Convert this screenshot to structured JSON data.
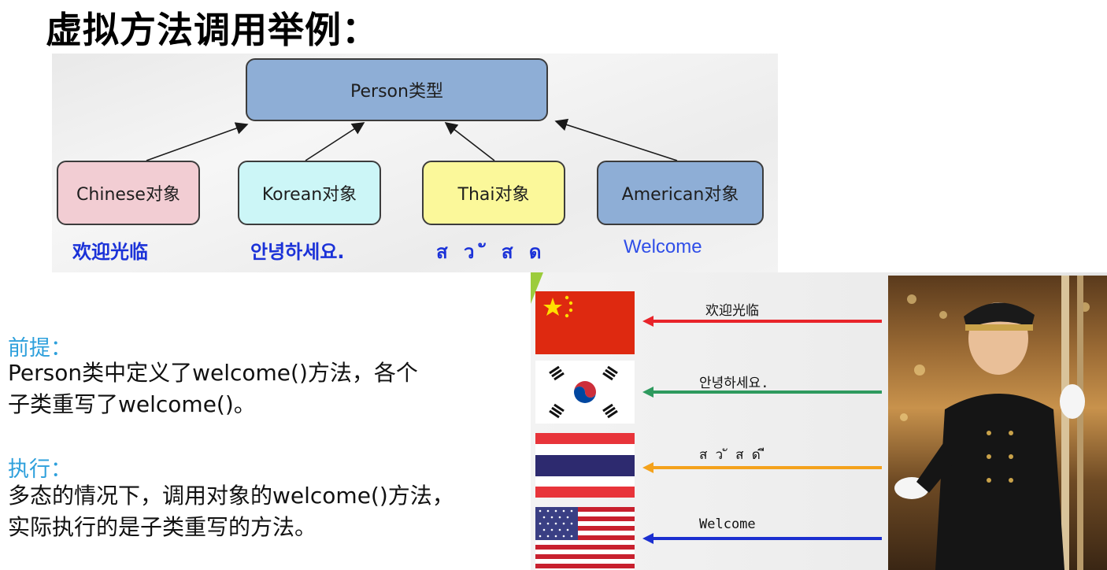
{
  "title": "虚拟方法调用举例：",
  "diagram": {
    "parent": "Person类型",
    "children": [
      {
        "label": "Chinese对象",
        "greeting": "欢迎光临"
      },
      {
        "label": "Korean对象",
        "greeting": "안녕하세요."
      },
      {
        "label": "Thai对象",
        "greeting": "ส ว ั ส ด"
      },
      {
        "label": "American对象",
        "greeting": "Welcome"
      }
    ],
    "colors": {
      "parent": "#8eaed6",
      "chinese": "#f2cdd3",
      "korean": "#ccf6f7",
      "thai": "#fbf89a",
      "american": "#8eaed6",
      "greeting": "#1b32d8"
    }
  },
  "premise": {
    "heading": "前提：",
    "lines": [
      "Person类中定义了welcome()方法，各个",
      "子类重写了welcome()。"
    ]
  },
  "execution": {
    "heading": "执行：",
    "lines": [
      "多态的情况下，调用对象的welcome()方法，",
      "实际执行的是子类重写的方法。"
    ]
  },
  "photo": {
    "labels": [
      "欢迎光临",
      "안녕하세요.",
      "ส ว ั ส ด ี",
      "Welcome"
    ],
    "arrow_colors": [
      "#e8242a",
      "#2e9a5e",
      "#f4a21c",
      "#1b2fd0"
    ],
    "flags": [
      "china-flag",
      "korea-flag",
      "thailand-flag",
      "usa-flag"
    ]
  }
}
